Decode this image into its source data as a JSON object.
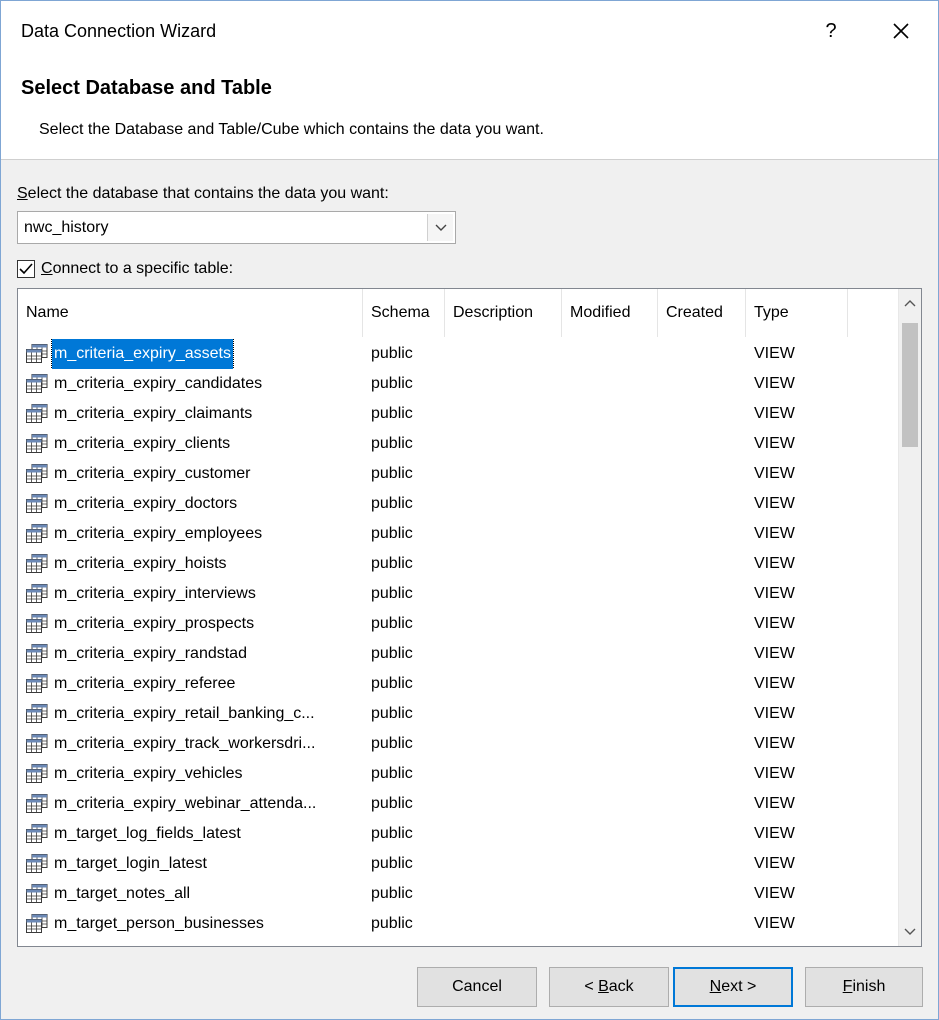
{
  "window": {
    "title": "Data Connection Wizard",
    "help": "?",
    "close_icon": "close-icon"
  },
  "header": {
    "title": "Select Database and Table",
    "subtitle": "Select the Database and Table/Cube which contains the data you want."
  },
  "database": {
    "label_accesskey": "S",
    "label_rest": "elect the database that contains the data you want:",
    "selected": "nwc_history"
  },
  "connect_specific": {
    "checked": true,
    "label_accesskey": "C",
    "label_rest": "onnect to a specific table:"
  },
  "table": {
    "columns": [
      "Name",
      "Schema",
      "Description",
      "Modified",
      "Created",
      "Type"
    ],
    "rows": [
      {
        "name": "m_criteria_expiry_assets",
        "schema": "public",
        "type": "VIEW",
        "selected": true
      },
      {
        "name": "m_criteria_expiry_candidates",
        "schema": "public",
        "type": "VIEW"
      },
      {
        "name": "m_criteria_expiry_claimants",
        "schema": "public",
        "type": "VIEW"
      },
      {
        "name": "m_criteria_expiry_clients",
        "schema": "public",
        "type": "VIEW"
      },
      {
        "name": "m_criteria_expiry_customer",
        "schema": "public",
        "type": "VIEW"
      },
      {
        "name": "m_criteria_expiry_doctors",
        "schema": "public",
        "type": "VIEW"
      },
      {
        "name": "m_criteria_expiry_employees",
        "schema": "public",
        "type": "VIEW"
      },
      {
        "name": "m_criteria_expiry_hoists",
        "schema": "public",
        "type": "VIEW"
      },
      {
        "name": "m_criteria_expiry_interviews",
        "schema": "public",
        "type": "VIEW"
      },
      {
        "name": "m_criteria_expiry_prospects",
        "schema": "public",
        "type": "VIEW"
      },
      {
        "name": "m_criteria_expiry_randstad",
        "schema": "public",
        "type": "VIEW"
      },
      {
        "name": "m_criteria_expiry_referee",
        "schema": "public",
        "type": "VIEW"
      },
      {
        "name": "m_criteria_expiry_retail_banking_c...",
        "schema": "public",
        "type": "VIEW"
      },
      {
        "name": "m_criteria_expiry_track_workersdri...",
        "schema": "public",
        "type": "VIEW"
      },
      {
        "name": "m_criteria_expiry_vehicles",
        "schema": "public",
        "type": "VIEW"
      },
      {
        "name": "m_criteria_expiry_webinar_attenda...",
        "schema": "public",
        "type": "VIEW"
      },
      {
        "name": "m_target_log_fields_latest",
        "schema": "public",
        "type": "VIEW"
      },
      {
        "name": "m_target_login_latest",
        "schema": "public",
        "type": "VIEW"
      },
      {
        "name": "m_target_notes_all",
        "schema": "public",
        "type": "VIEW"
      },
      {
        "name": "m_target_person_businesses",
        "schema": "public",
        "type": "VIEW"
      }
    ],
    "row_icon": "table-view-icon"
  },
  "buttons": {
    "cancel": "Cancel",
    "back_prefix": "< ",
    "back_accesskey": "B",
    "back_rest": "ack",
    "next_accesskey": "N",
    "next_rest": "ext >",
    "finish_accesskey": "F",
    "finish_rest": "inish"
  },
  "colors": {
    "selection": "#0078d7",
    "default_button_border": "#0078d7",
    "window_border": "#7fa6d4"
  }
}
